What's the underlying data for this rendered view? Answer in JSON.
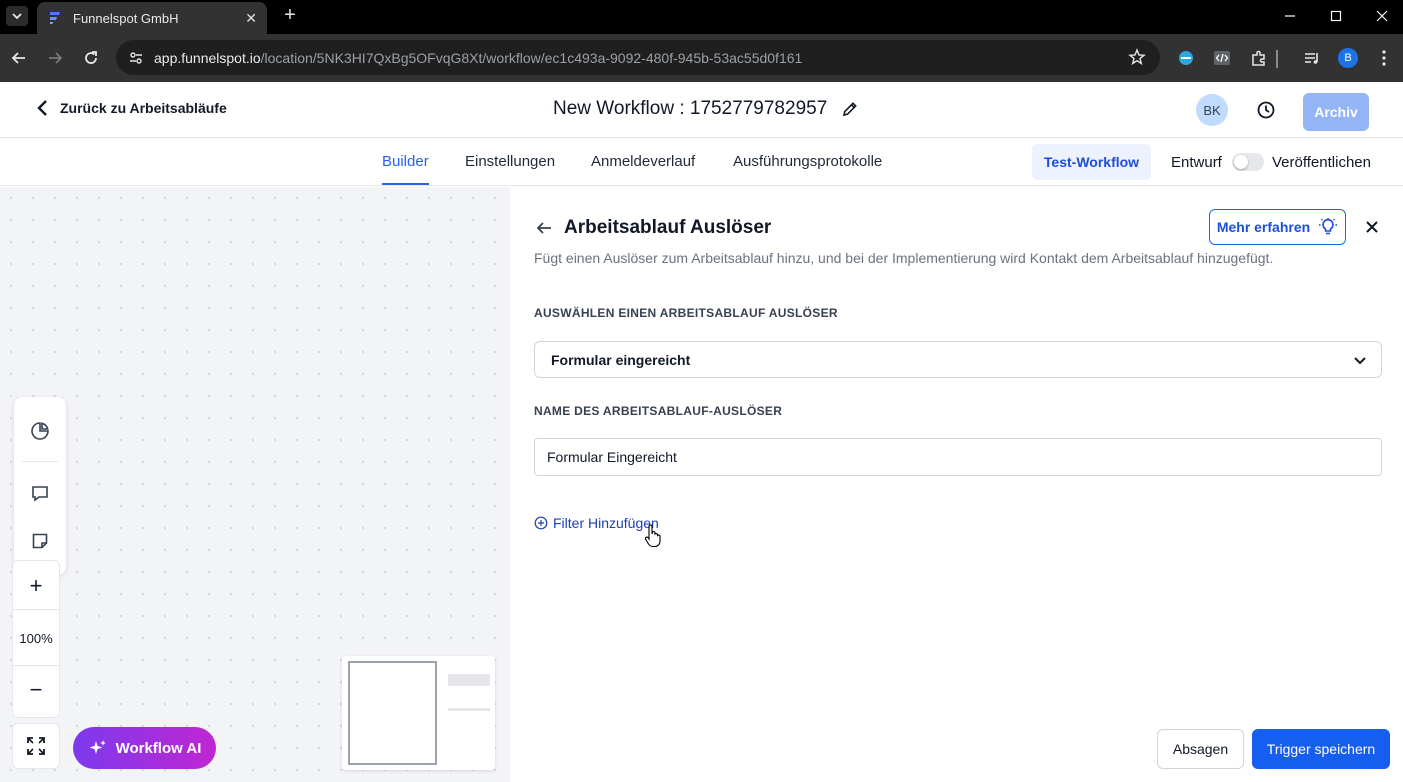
{
  "browser": {
    "tab_title": "Funnelspot GmbH",
    "url_host": "app.funnelspot.io",
    "url_path": "/location/5NK3HI7QxBg5OFvqG8Xt/workflow/ec1c493a-9092-480f-945b-53ac55d0f161",
    "profile_initial": "B"
  },
  "header": {
    "back_label": "Zurück zu Arbeitsabläufe",
    "workflow_title": "New Workflow : 1752779782957",
    "avatar_initials": "BK",
    "archive_label": "Archiv"
  },
  "subnav": {
    "tabs": [
      {
        "label": "Builder",
        "active": true
      },
      {
        "label": "Einstellungen",
        "active": false
      },
      {
        "label": "Anmeldeverlauf",
        "active": false
      },
      {
        "label": "Ausführungsprotokolle",
        "active": false
      }
    ],
    "test_label": "Test-Workflow",
    "draft_label": "Entwurf",
    "publish_toggle_on": false,
    "publish_label": "Veröffentlichen"
  },
  "canvas": {
    "zoom": "100%",
    "ai_label": "Workflow AI"
  },
  "panel": {
    "title": "Arbeitsablauf Auslöser",
    "learn_more_label": "Mehr erfahren",
    "description": "Fügt einen Auslöser zum Arbeitsablauf hinzu, und bei der Implementierung wird Kontakt dem Arbeitsablauf hinzugefügt.",
    "select_label": "AUSWÄHLEN EINEN ARBEITSABLAUF AUSLÖSER",
    "select_value": "Formular eingereicht",
    "name_label": "NAME DES ARBEITSABLAUF-AUSLÖSER",
    "name_value": "Formular Eingereicht",
    "add_filter_label": "Filter Hinzufügen",
    "cancel_label": "Absagen",
    "save_label": "Trigger speichern"
  },
  "colors": {
    "accent": "#2563eb",
    "primary_button": "#155eef",
    "archive_button": "#93b4f5",
    "ai_gradient_start": "#7c3aed",
    "ai_gradient_end": "#c026d3"
  }
}
